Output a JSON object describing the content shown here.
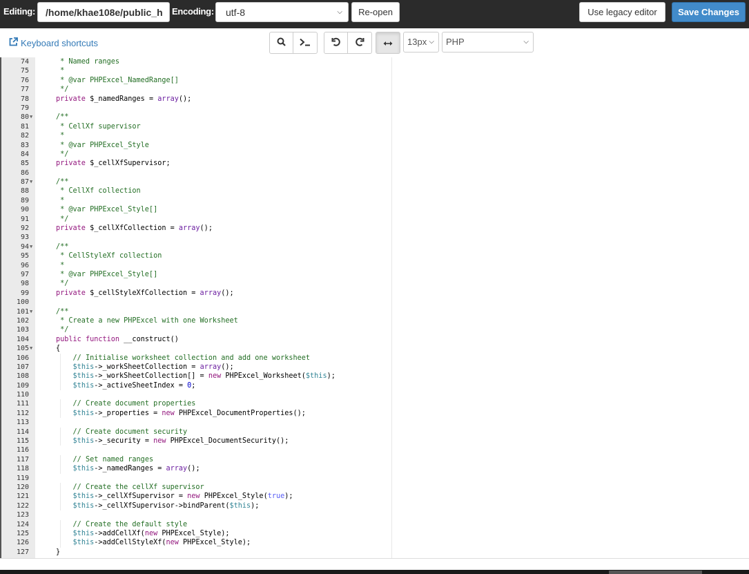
{
  "topbar": {
    "editing_label": "Editing:",
    "file_path": "/home/khae108e/public_h",
    "encoding_label": "Encoding:",
    "encoding_value": "utf-8",
    "reopen_label": "Re-open",
    "legacy_label": "Use legacy editor",
    "save_label": "Save Changes",
    "save_color": "#428bca"
  },
  "toolbar": {
    "keyboard_shortcuts": "Keyboard shortcuts",
    "font_size": "13px",
    "language": "PHP",
    "icons": [
      "search-icon",
      "terminal-icon",
      "undo-icon",
      "redo-icon",
      "wrap-toggle-icon"
    ]
  },
  "editor": {
    "lines": [
      {
        "n": "74",
        "fold": false,
        "indent": 1,
        "seg": [
          [
            " * Named ranges",
            "cm"
          ]
        ]
      },
      {
        "n": "75",
        "fold": false,
        "indent": 1,
        "seg": [
          [
            " *",
            "cm"
          ]
        ]
      },
      {
        "n": "76",
        "fold": false,
        "indent": 1,
        "seg": [
          [
            " * @var PHPExcel_NamedRange[]",
            "cm"
          ]
        ]
      },
      {
        "n": "77",
        "fold": false,
        "indent": 1,
        "seg": [
          [
            " */",
            "cm"
          ]
        ]
      },
      {
        "n": "78",
        "fold": false,
        "indent": 1,
        "seg": [
          [
            "private",
            "kw"
          ],
          [
            " $_namedRanges = ",
            ""
          ],
          [
            "array",
            "kw2"
          ],
          [
            "();",
            ""
          ]
        ]
      },
      {
        "n": "79",
        "fold": false,
        "indent": 0,
        "seg": []
      },
      {
        "n": "80",
        "fold": true,
        "indent": 1,
        "seg": [
          [
            "/**",
            "cm"
          ]
        ]
      },
      {
        "n": "81",
        "fold": false,
        "indent": 1,
        "seg": [
          [
            " * CellXf supervisor",
            "cm"
          ]
        ]
      },
      {
        "n": "82",
        "fold": false,
        "indent": 1,
        "seg": [
          [
            " *",
            "cm"
          ]
        ]
      },
      {
        "n": "83",
        "fold": false,
        "indent": 1,
        "seg": [
          [
            " * @var PHPExcel_Style",
            "cm"
          ]
        ]
      },
      {
        "n": "84",
        "fold": false,
        "indent": 1,
        "seg": [
          [
            " */",
            "cm"
          ]
        ]
      },
      {
        "n": "85",
        "fold": false,
        "indent": 1,
        "seg": [
          [
            "private",
            "kw"
          ],
          [
            " $_cellXfSupervisor;",
            ""
          ]
        ]
      },
      {
        "n": "86",
        "fold": false,
        "indent": 0,
        "seg": []
      },
      {
        "n": "87",
        "fold": true,
        "indent": 1,
        "seg": [
          [
            "/**",
            "cm"
          ]
        ]
      },
      {
        "n": "88",
        "fold": false,
        "indent": 1,
        "seg": [
          [
            " * CellXf collection",
            "cm"
          ]
        ]
      },
      {
        "n": "89",
        "fold": false,
        "indent": 1,
        "seg": [
          [
            " *",
            "cm"
          ]
        ]
      },
      {
        "n": "90",
        "fold": false,
        "indent": 1,
        "seg": [
          [
            " * @var PHPExcel_Style[]",
            "cm"
          ]
        ]
      },
      {
        "n": "91",
        "fold": false,
        "indent": 1,
        "seg": [
          [
            " */",
            "cm"
          ]
        ]
      },
      {
        "n": "92",
        "fold": false,
        "indent": 1,
        "seg": [
          [
            "private",
            "kw"
          ],
          [
            " $_cellXfCollection = ",
            ""
          ],
          [
            "array",
            "kw2"
          ],
          [
            "();",
            ""
          ]
        ]
      },
      {
        "n": "93",
        "fold": false,
        "indent": 0,
        "seg": []
      },
      {
        "n": "94",
        "fold": true,
        "indent": 1,
        "seg": [
          [
            "/**",
            "cm"
          ]
        ]
      },
      {
        "n": "95",
        "fold": false,
        "indent": 1,
        "seg": [
          [
            " * CellStyleXf collection",
            "cm"
          ]
        ]
      },
      {
        "n": "96",
        "fold": false,
        "indent": 1,
        "seg": [
          [
            " *",
            "cm"
          ]
        ]
      },
      {
        "n": "97",
        "fold": false,
        "indent": 1,
        "seg": [
          [
            " * @var PHPExcel_Style[]",
            "cm"
          ]
        ]
      },
      {
        "n": "98",
        "fold": false,
        "indent": 1,
        "seg": [
          [
            " */",
            "cm"
          ]
        ]
      },
      {
        "n": "99",
        "fold": false,
        "indent": 1,
        "seg": [
          [
            "private",
            "kw"
          ],
          [
            " $_cellStyleXfCollection = ",
            ""
          ],
          [
            "array",
            "kw2"
          ],
          [
            "();",
            ""
          ]
        ]
      },
      {
        "n": "100",
        "fold": false,
        "indent": 0,
        "seg": []
      },
      {
        "n": "101",
        "fold": true,
        "indent": 1,
        "seg": [
          [
            "/**",
            "cm"
          ]
        ]
      },
      {
        "n": "102",
        "fold": false,
        "indent": 1,
        "seg": [
          [
            " * Create a new PHPExcel with one Worksheet",
            "cm"
          ]
        ]
      },
      {
        "n": "103",
        "fold": false,
        "indent": 1,
        "seg": [
          [
            " */",
            "cm"
          ]
        ]
      },
      {
        "n": "104",
        "fold": false,
        "indent": 1,
        "seg": [
          [
            "public",
            "kw"
          ],
          [
            " ",
            ""
          ],
          [
            "function",
            "kw"
          ],
          [
            " __construct()",
            ""
          ]
        ]
      },
      {
        "n": "105",
        "fold": true,
        "indent": 1,
        "seg": [
          [
            "{",
            ""
          ]
        ]
      },
      {
        "n": "106",
        "fold": false,
        "indent": 2,
        "seg": [
          [
            "    ",
            ""
          ],
          [
            "// Initialise worksheet collection and add one worksheet",
            "cm"
          ]
        ]
      },
      {
        "n": "107",
        "fold": false,
        "indent": 2,
        "seg": [
          [
            "    ",
            ""
          ],
          [
            "$this",
            "var"
          ],
          [
            "->_workSheetCollection = ",
            ""
          ],
          [
            "array",
            "kw2"
          ],
          [
            "();",
            ""
          ]
        ]
      },
      {
        "n": "108",
        "fold": false,
        "indent": 2,
        "seg": [
          [
            "    ",
            ""
          ],
          [
            "$this",
            "var"
          ],
          [
            "->_workSheetCollection[] = ",
            ""
          ],
          [
            "new",
            "new"
          ],
          [
            " PHPExcel_Worksheet(",
            ""
          ],
          [
            "$this",
            "var"
          ],
          [
            ");",
            ""
          ]
        ]
      },
      {
        "n": "109",
        "fold": false,
        "indent": 2,
        "seg": [
          [
            "    ",
            ""
          ],
          [
            "$this",
            "var"
          ],
          [
            "->_activeSheetIndex = ",
            ""
          ],
          [
            "0",
            "num"
          ],
          [
            ";",
            ""
          ]
        ]
      },
      {
        "n": "110",
        "fold": false,
        "indent": 0,
        "seg": []
      },
      {
        "n": "111",
        "fold": false,
        "indent": 2,
        "seg": [
          [
            "    ",
            ""
          ],
          [
            "// Create document properties",
            "cm"
          ]
        ]
      },
      {
        "n": "112",
        "fold": false,
        "indent": 2,
        "seg": [
          [
            "    ",
            ""
          ],
          [
            "$this",
            "var"
          ],
          [
            "->_properties = ",
            ""
          ],
          [
            "new",
            "new"
          ],
          [
            " PHPExcel_DocumentProperties();",
            ""
          ]
        ]
      },
      {
        "n": "113",
        "fold": false,
        "indent": 0,
        "seg": []
      },
      {
        "n": "114",
        "fold": false,
        "indent": 2,
        "seg": [
          [
            "    ",
            ""
          ],
          [
            "// Create document security",
            "cm"
          ]
        ]
      },
      {
        "n": "115",
        "fold": false,
        "indent": 2,
        "seg": [
          [
            "    ",
            ""
          ],
          [
            "$this",
            "var"
          ],
          [
            "->_security = ",
            ""
          ],
          [
            "new",
            "new"
          ],
          [
            " PHPExcel_DocumentSecurity();",
            ""
          ]
        ]
      },
      {
        "n": "116",
        "fold": false,
        "indent": 0,
        "seg": []
      },
      {
        "n": "117",
        "fold": false,
        "indent": 2,
        "seg": [
          [
            "    ",
            ""
          ],
          [
            "// Set named ranges",
            "cm"
          ]
        ]
      },
      {
        "n": "118",
        "fold": false,
        "indent": 2,
        "seg": [
          [
            "    ",
            ""
          ],
          [
            "$this",
            "var"
          ],
          [
            "->_namedRanges = ",
            ""
          ],
          [
            "array",
            "kw2"
          ],
          [
            "();",
            ""
          ]
        ]
      },
      {
        "n": "119",
        "fold": false,
        "indent": 0,
        "seg": []
      },
      {
        "n": "120",
        "fold": false,
        "indent": 2,
        "seg": [
          [
            "    ",
            ""
          ],
          [
            "// Create the cellXf supervisor",
            "cm"
          ]
        ]
      },
      {
        "n": "121",
        "fold": false,
        "indent": 2,
        "seg": [
          [
            "    ",
            ""
          ],
          [
            "$this",
            "var"
          ],
          [
            "->_cellXfSupervisor = ",
            ""
          ],
          [
            "new",
            "new"
          ],
          [
            " PHPExcel_Style(",
            ""
          ],
          [
            "true",
            "bool"
          ],
          [
            ");",
            ""
          ]
        ]
      },
      {
        "n": "122",
        "fold": false,
        "indent": 2,
        "seg": [
          [
            "    ",
            ""
          ],
          [
            "$this",
            "var"
          ],
          [
            "->_cellXfSupervisor->bindParent(",
            ""
          ],
          [
            "$this",
            "var"
          ],
          [
            ");",
            ""
          ]
        ]
      },
      {
        "n": "123",
        "fold": false,
        "indent": 0,
        "seg": []
      },
      {
        "n": "124",
        "fold": false,
        "indent": 2,
        "seg": [
          [
            "    ",
            ""
          ],
          [
            "// Create the default style",
            "cm"
          ]
        ]
      },
      {
        "n": "125",
        "fold": false,
        "indent": 2,
        "seg": [
          [
            "    ",
            ""
          ],
          [
            "$this",
            "var"
          ],
          [
            "->addCellXf(",
            ""
          ],
          [
            "new",
            "new"
          ],
          [
            " PHPExcel_Style);",
            ""
          ]
        ]
      },
      {
        "n": "126",
        "fold": false,
        "indent": 2,
        "seg": [
          [
            "    ",
            ""
          ],
          [
            "$this",
            "var"
          ],
          [
            "->addCellStyleXf(",
            ""
          ],
          [
            "new",
            "new"
          ],
          [
            " PHPExcel_Style);",
            ""
          ]
        ]
      },
      {
        "n": "127",
        "fold": false,
        "indent": 1,
        "seg": [
          [
            "}",
            ""
          ]
        ]
      }
    ]
  }
}
